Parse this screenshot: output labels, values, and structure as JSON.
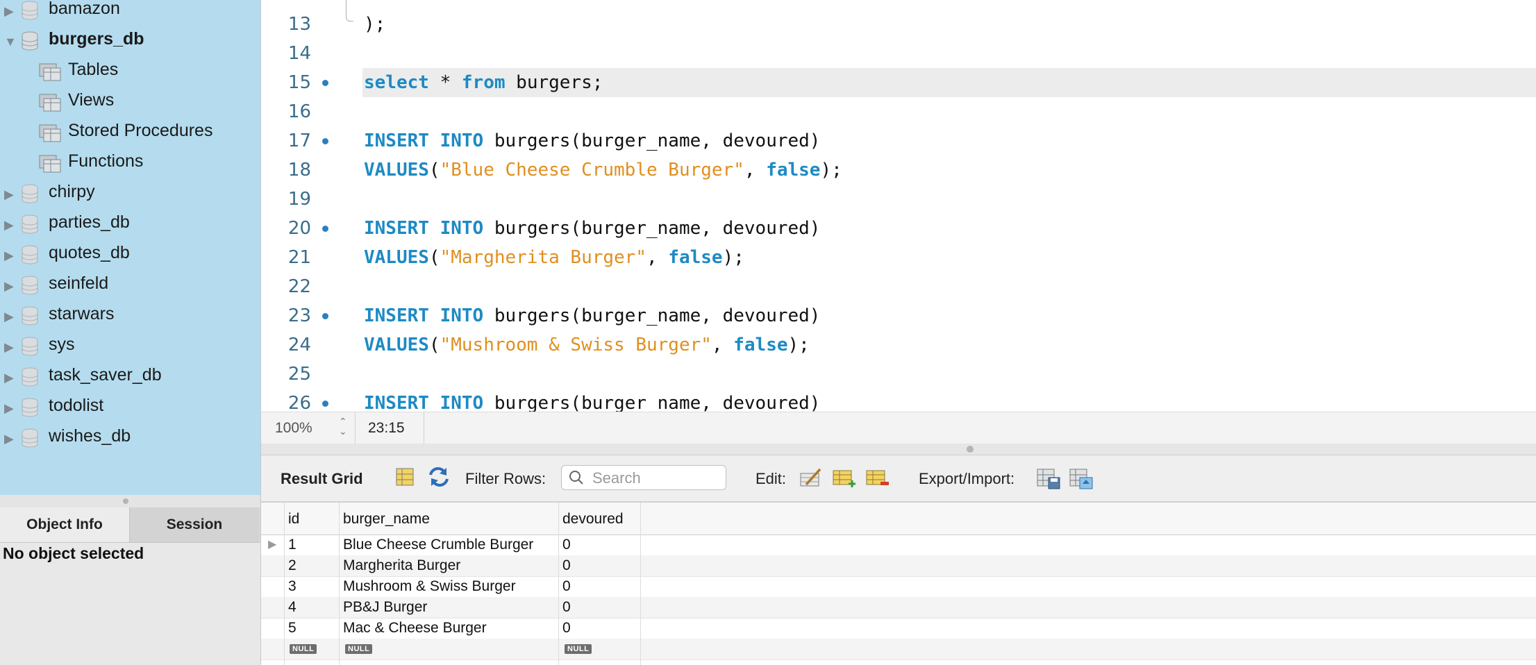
{
  "sidebar": {
    "databases": [
      {
        "name": "bamazon",
        "expanded": false
      },
      {
        "name": "burgers_db",
        "expanded": true,
        "children": [
          "Tables",
          "Views",
          "Stored Procedures",
          "Functions"
        ]
      },
      {
        "name": "chirpy",
        "expanded": false
      },
      {
        "name": "parties_db",
        "expanded": false
      },
      {
        "name": "quotes_db",
        "expanded": false
      },
      {
        "name": "seinfeld",
        "expanded": false
      },
      {
        "name": "starwars",
        "expanded": false
      },
      {
        "name": "sys",
        "expanded": false
      },
      {
        "name": "task_saver_db",
        "expanded": false
      },
      {
        "name": "todolist",
        "expanded": false
      },
      {
        "name": "wishes_db",
        "expanded": false
      }
    ],
    "tabs": {
      "object_info": "Object Info",
      "session": "Session"
    },
    "info_message": "No object selected"
  },
  "editor": {
    "lines": [
      {
        "num": "13",
        "text": ");"
      },
      {
        "num": "14",
        "text": ""
      },
      {
        "num": "15",
        "text": "select * from burgers;"
      },
      {
        "num": "16",
        "text": ""
      },
      {
        "num": "17",
        "text": "INSERT INTO burgers(burger_name, devoured)"
      },
      {
        "num": "18",
        "text": "VALUES(\"Blue Cheese Crumble Burger\", false);"
      },
      {
        "num": "19",
        "text": ""
      },
      {
        "num": "20",
        "text": "INSERT INTO burgers(burger_name, devoured)"
      },
      {
        "num": "21",
        "text": "VALUES(\"Margherita Burger\", false);"
      },
      {
        "num": "22",
        "text": ""
      },
      {
        "num": "23",
        "text": "INSERT INTO burgers(burger_name, devoured)"
      },
      {
        "num": "24",
        "text": "VALUES(\"Mushroom & Swiss Burger\", false);"
      },
      {
        "num": "25",
        "text": ""
      },
      {
        "num": "26",
        "text": "INSERT INTO burgers(burger_name, devoured)"
      }
    ],
    "tokens": {
      "select": "select",
      "star": " * ",
      "from": "from",
      "table_semicolon": " burgers;",
      "insert": "INSERT",
      "into": "INTO",
      "insert_rest": " burgers(burger_name, devoured)",
      "values": "VALUES",
      "open": "(",
      "comma": ", ",
      "false": "false",
      "close": ");",
      "str1": "\"Blue Cheese Crumble Burger\"",
      "str2": "\"Margherita Burger\"",
      "str3": "\"Mushroom & Swiss Burger\""
    }
  },
  "status_bar": {
    "zoom": "100%",
    "cursor_position": "23:15"
  },
  "result_toolbar": {
    "result_grid_label": "Result Grid",
    "filter_rows_label": "Filter Rows:",
    "search_placeholder": "Search",
    "edit_label": "Edit:",
    "export_import_label": "Export/Import:"
  },
  "grid": {
    "columns": [
      "id",
      "burger_name",
      "devoured"
    ],
    "rows": [
      [
        "1",
        "Blue Cheese Crumble Burger",
        "0"
      ],
      [
        "2",
        "Margherita Burger",
        "0"
      ],
      [
        "3",
        "Mushroom & Swiss Burger",
        "0"
      ],
      [
        "4",
        "PB&J Burger",
        "0"
      ],
      [
        "5",
        "Mac & Cheese Burger",
        "0"
      ]
    ],
    "null_label": "NULL"
  },
  "colors": {
    "sidebar_bg": "#b4dcee",
    "keyword": "#1d8ac4",
    "string": "#e08f1f",
    "breakpoint": "#2a7fc0"
  }
}
